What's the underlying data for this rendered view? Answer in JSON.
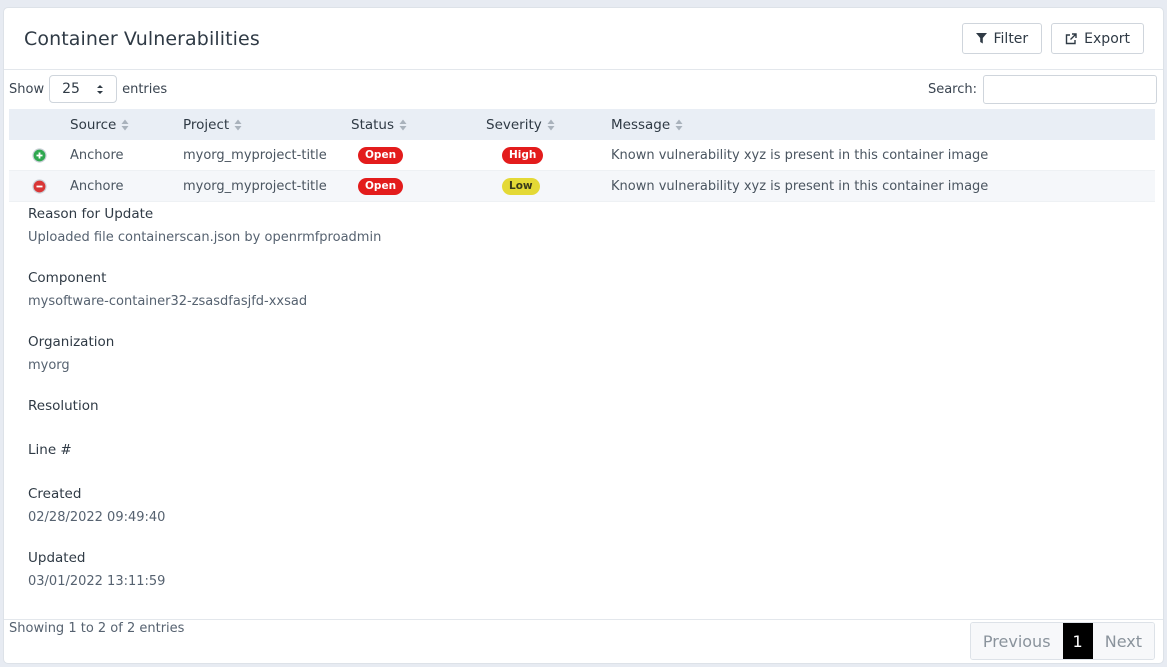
{
  "header": {
    "title": "Container Vulnerabilities",
    "filter_label": "Filter",
    "export_label": "Export"
  },
  "controls": {
    "show_label": "Show",
    "entries_value": "25",
    "entries_label": "entries",
    "search_label": "Search:",
    "search_value": ""
  },
  "table": {
    "columns": [
      "Source",
      "Project",
      "Status",
      "Severity",
      "Message"
    ],
    "rows": [
      {
        "control": "expand-icon",
        "source": "Anchore",
        "project": "myorg_myproject-title",
        "status": "Open",
        "severity": "High",
        "message": "Known vulnerability xyz is present in this container image"
      },
      {
        "control": "collapse-icon",
        "source": "Anchore",
        "project": "myorg_myproject-title",
        "status": "Open",
        "severity": "Low",
        "message": "Known vulnerability xyz is present in this container image"
      }
    ]
  },
  "details": [
    {
      "label": "Reason for Update",
      "value": "Uploaded file containerscan.json by openrmfproadmin"
    },
    {
      "label": "Component",
      "value": "mysoftware-container32-zsasdfasjfd-xxsad"
    },
    {
      "label": "Organization",
      "value": "myorg"
    },
    {
      "label": "Resolution",
      "value": ""
    },
    {
      "label": "Line #",
      "value": ""
    },
    {
      "label": "Created",
      "value": "02/28/2022 09:49:40"
    },
    {
      "label": "Updated",
      "value": "03/01/2022 13:11:59"
    }
  ],
  "footer": {
    "info": "Showing 1 to 2 of 2 entries",
    "previous_label": "Previous",
    "page": "1",
    "next_label": "Next"
  },
  "colors": {
    "open": "#e31c1c",
    "high": "#e31c1c",
    "low": "#e4d936",
    "expand": "#2fa84f",
    "collapse": "#d93636"
  }
}
